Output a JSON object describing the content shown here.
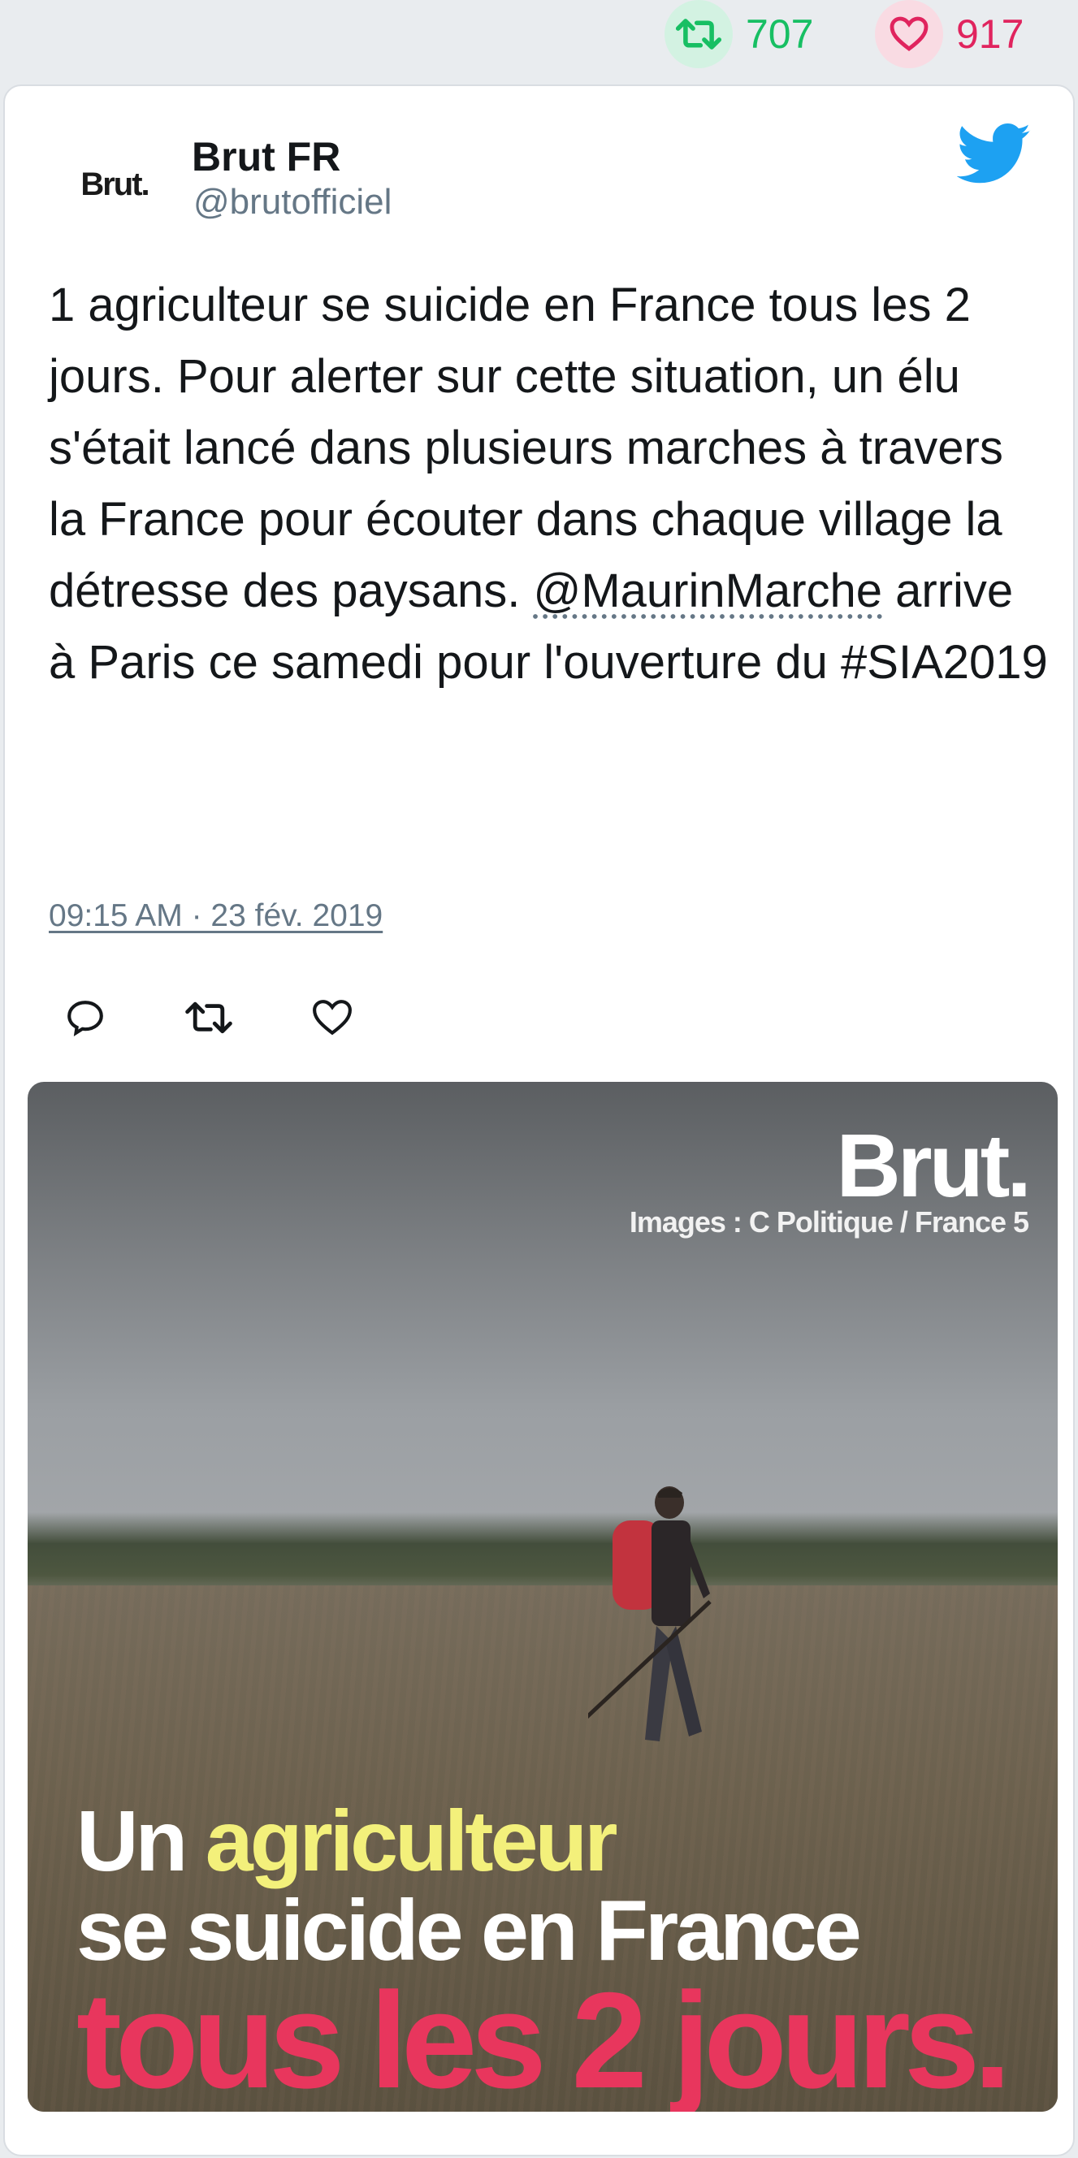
{
  "stats": {
    "retweets": "707",
    "likes": "917",
    "retweet_color": "#17bf63",
    "like_color": "#e0245e"
  },
  "author": {
    "avatar_text": "Brut.",
    "name": "Brut FR",
    "handle": "@brutofficiel"
  },
  "tweet": {
    "text_before": "1 agriculteur se suicide en France tous les 2 jours. Pour alerter sur cette situation, un élu s'était lancé dans plusieurs marches à travers la France pour écouter dans chaque village la détresse des paysans. ",
    "mention": "@MaurinMarche",
    "text_after": " arrive à Paris ce samedi pour l'ouverture du #SIA2019",
    "timestamp": "09:15 AM · 23 fév. 2019"
  },
  "actions": [
    "reply-icon",
    "retweet-icon",
    "like-icon"
  ],
  "media": {
    "brand": "Brut.",
    "credit": "Images : C Politique / France 5",
    "overlay_word1": "Un ",
    "overlay_highlight": "agriculteur",
    "overlay_line2": "se suicide en France",
    "overlay_line3": "tous les 2 jours.",
    "highlight_color": "#f3f07b",
    "emphasis_color": "#e8365d"
  },
  "twitter_blue": "#1da1f2"
}
